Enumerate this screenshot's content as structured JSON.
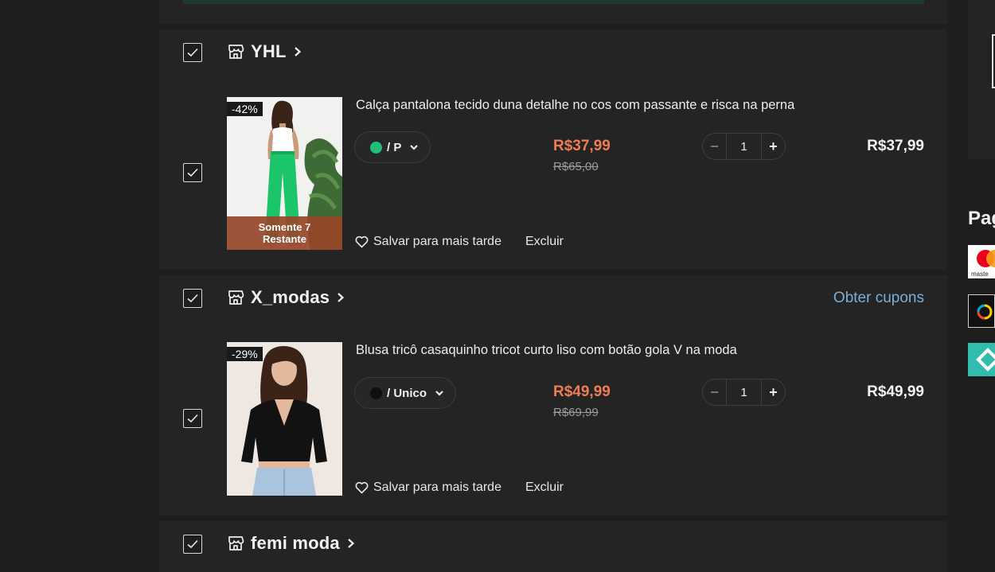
{
  "stores": [
    {
      "name": "YHL",
      "checked": true,
      "coupon_label": "",
      "product": {
        "title": "Calça pantalona tecido duna detalhe no cos com passante e risca na perna",
        "discount": "-42%",
        "stock_note": "Somente 7 Restante",
        "variant_color": "#1fbf7a",
        "variant_label": "/ P",
        "price": "R$37,99",
        "original_price": "R$65,00",
        "quantity": "1",
        "line_total": "R$37,99",
        "checked": true
      }
    },
    {
      "name": "X_modas",
      "checked": true,
      "coupon_label": "Obter cupons",
      "product": {
        "title": "Blusa tricô casaquinho tricot curto liso com botão gola V na moda",
        "discount": "-29%",
        "stock_note": "",
        "variant_color": "#0f0f0f",
        "variant_label": "/ Unico",
        "price": "R$49,99",
        "original_price": "R$69,99",
        "quantity": "1",
        "line_total": "R$49,99",
        "checked": true
      }
    },
    {
      "name": "femi moda",
      "checked": true
    }
  ],
  "actions": {
    "save_later": "Salvar para mais tarde",
    "delete": "Excluir"
  },
  "stepper": {
    "minus": "−",
    "plus": "+"
  },
  "side_panel": {
    "title_fragment": "Pag",
    "payment_icons": [
      "mastercard-icon",
      "elo-icon",
      "pix-icon"
    ],
    "mastercard_fragment": "maste"
  },
  "colors": {
    "background": "#1e1e1e",
    "card": "#232423",
    "price_accent": "#ef7c55",
    "link": "#7aaed6"
  }
}
